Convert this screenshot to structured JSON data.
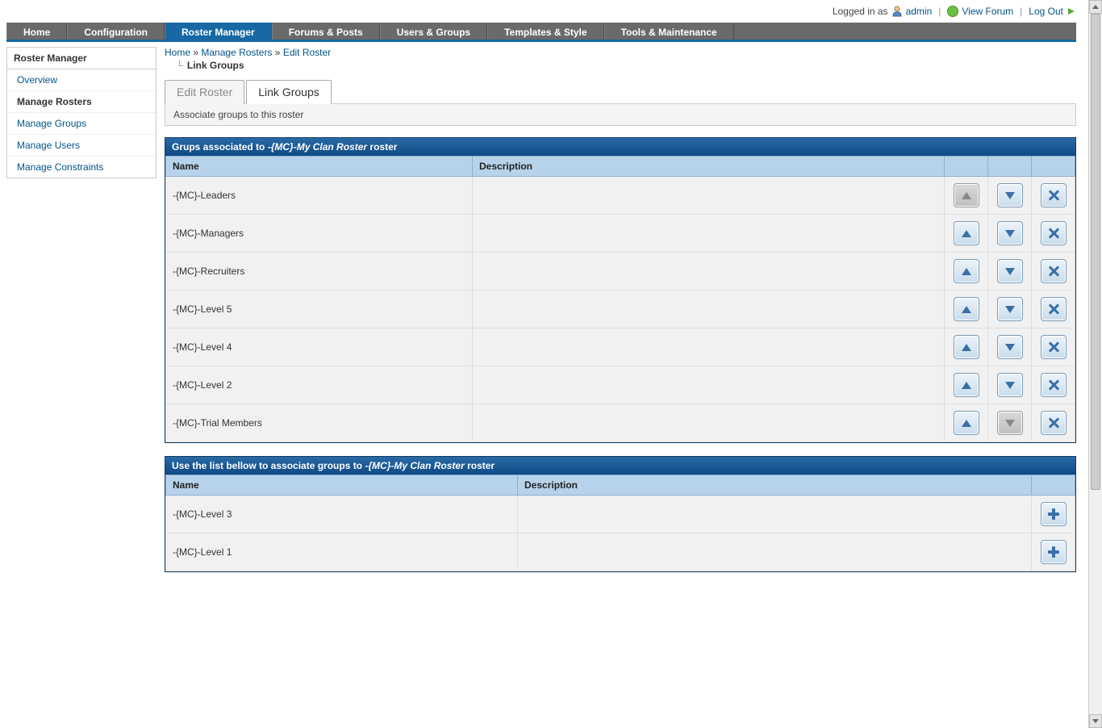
{
  "userbar": {
    "logged_in_as": "Logged in as",
    "username": "admin",
    "view_forum": "View Forum",
    "logout": "Log Out"
  },
  "nav": {
    "items": [
      {
        "label": "Home"
      },
      {
        "label": "Configuration"
      },
      {
        "label": "Roster Manager",
        "active": true
      },
      {
        "label": "Forums & Posts"
      },
      {
        "label": "Users & Groups"
      },
      {
        "label": "Templates & Style"
      },
      {
        "label": "Tools & Maintenance"
      }
    ]
  },
  "sidebar": {
    "title": "Roster Manager",
    "items": [
      {
        "label": "Overview"
      },
      {
        "label": "Manage Rosters",
        "active": true
      },
      {
        "label": "Manage Groups"
      },
      {
        "label": "Manage Users"
      },
      {
        "label": "Manage Constraints"
      }
    ]
  },
  "breadcrumb": {
    "home": "Home",
    "manage_rosters": "Manage Rosters",
    "edit_roster": "Edit Roster",
    "current": "Link Groups",
    "sep": "»"
  },
  "tabs": {
    "edit_roster": "Edit Roster",
    "link_groups": "Link Groups",
    "description": "Associate groups to this roster"
  },
  "panel1": {
    "head_pre": "Grups associated to ",
    "roster_name": "-{MC}-My Clan Roster",
    "head_post": " roster",
    "col_name": "Name",
    "col_desc": "Description",
    "rows": [
      {
        "name": "-{MC}-Leaders",
        "desc": "",
        "up_disabled": true,
        "down_disabled": false
      },
      {
        "name": "-{MC}-Managers",
        "desc": "",
        "up_disabled": false,
        "down_disabled": false
      },
      {
        "name": "-{MC}-Recruiters",
        "desc": "",
        "up_disabled": false,
        "down_disabled": false
      },
      {
        "name": "-{MC}-Level 5",
        "desc": "",
        "up_disabled": false,
        "down_disabled": false
      },
      {
        "name": "-{MC}-Level 4",
        "desc": "",
        "up_disabled": false,
        "down_disabled": false
      },
      {
        "name": "-{MC}-Level 2",
        "desc": "",
        "up_disabled": false,
        "down_disabled": false
      },
      {
        "name": "-{MC}-Trial Members",
        "desc": "",
        "up_disabled": false,
        "down_disabled": true
      }
    ]
  },
  "panel2": {
    "head_pre": "Use the list bellow to associate groups to ",
    "roster_name": "-{MC}-My Clan Roster",
    "head_post": " roster",
    "col_name": "Name",
    "col_desc": "Description",
    "rows": [
      {
        "name": "-{MC}-Level 3",
        "desc": ""
      },
      {
        "name": "-{MC}-Level 1",
        "desc": ""
      }
    ]
  }
}
